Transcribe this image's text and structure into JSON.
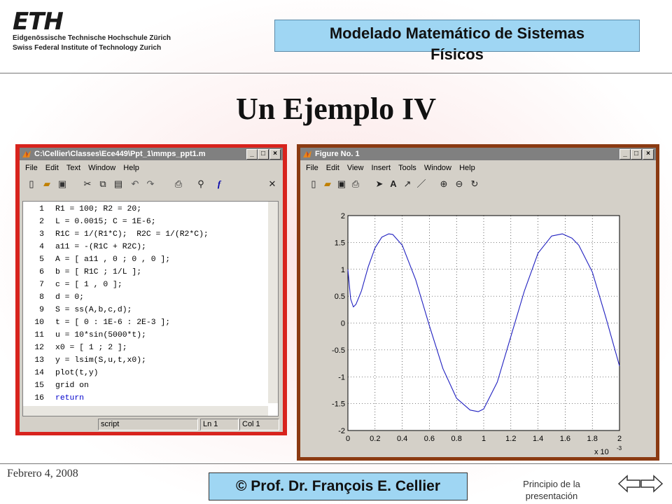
{
  "header": {
    "eth_mark": "ETH",
    "eth_line1": "Eidgenössische Technische Hochschule Zürich",
    "eth_line2": "Swiss Federal Institute of Technology Zurich",
    "course_title_line1": "Modelado Matemático de Sistemas",
    "course_title_line2": "Físicos"
  },
  "slide_title": "Un Ejemplo IV",
  "footer": {
    "date": "Febrero 4, 2008",
    "author": "©  Prof. Dr. François E. Cellier",
    "nav_link_line1": "Principio de la",
    "nav_link_line2": "presentación"
  },
  "editor": {
    "title": "C:\\Cellier\\Classes\\Ece449\\Ppt_1\\mmps_ppt1.m",
    "menu": [
      "File",
      "Edit",
      "Text",
      "Window",
      "Help"
    ],
    "lines": [
      {
        "n": "1",
        "code": "R1 = 100; R2 = 20;"
      },
      {
        "n": "2",
        "code": "L = 0.0015; C = 1E-6;"
      },
      {
        "n": "3",
        "code": "R1C = 1/(R1*C);  R2C = 1/(R2*C);"
      },
      {
        "n": "4",
        "code": "a11 = -(R1C + R2C);"
      },
      {
        "n": "5",
        "code": "A = [ a11 , 0 ; 0 , 0 ];"
      },
      {
        "n": "6",
        "code": "b = [ R1C ; 1/L ];"
      },
      {
        "n": "7",
        "code": "c = [ 1 , 0 ];"
      },
      {
        "n": "8",
        "code": "d = 0;"
      },
      {
        "n": "9",
        "code": "S = ss(A,b,c,d);"
      },
      {
        "n": "10",
        "code": "t = [ 0 : 1E-6 : 2E-3 ];"
      },
      {
        "n": "11",
        "code": "u = 10*sin(5000*t);"
      },
      {
        "n": "12",
        "code": "x0 = [ 1 ; 2 ];"
      },
      {
        "n": "13",
        "code": "y = lsim(S,u,t,x0);"
      },
      {
        "n": "14",
        "code": "plot(t,y)"
      },
      {
        "n": "15",
        "code": "grid on"
      },
      {
        "n": "16",
        "code": "return"
      }
    ],
    "keyword_color": "#0000cc",
    "status": {
      "mode": "script",
      "line": "Ln 1",
      "col": "Col 1"
    }
  },
  "figure": {
    "title": "Figure No. 1",
    "menu": [
      "File",
      "Edit",
      "View",
      "Insert",
      "Tools",
      "Window",
      "Help"
    ],
    "x_exponent_label": "x 10",
    "x_exponent_power": "-3"
  },
  "chart_data": {
    "type": "line",
    "title": "",
    "xlabel": "",
    "ylabel": "",
    "xlim": [
      0,
      2
    ],
    "ylim": [
      -2,
      2
    ],
    "grid": true,
    "x_ticks": [
      0,
      0.2,
      0.4,
      0.6,
      0.8,
      1,
      1.2,
      1.4,
      1.6,
      1.8,
      2
    ],
    "x_tick_labels": [
      "0",
      "0.2",
      "0.4",
      "0.6",
      "0.8",
      "1",
      "1.2",
      "1.4",
      "1.6",
      "1.8",
      "2"
    ],
    "y_ticks": [
      2,
      1.5,
      1,
      0.5,
      0,
      -0.5,
      -1,
      -1.5,
      -2
    ],
    "y_tick_labels": [
      "2",
      "1.5",
      "1",
      "0.5",
      "0",
      "-0.5",
      "-1",
      "-1.5",
      "-2"
    ],
    "series": [
      {
        "color": "#2020c0",
        "x": [
          0,
          0.02,
          0.04,
          0.06,
          0.1,
          0.15,
          0.2,
          0.25,
          0.3,
          0.33,
          0.4,
          0.5,
          0.6,
          0.7,
          0.8,
          0.9,
          0.96,
          1.0,
          1.1,
          1.2,
          1.3,
          1.4,
          1.5,
          1.58,
          1.65,
          1.7,
          1.8,
          1.9,
          2.0
        ],
        "y": [
          1.0,
          0.45,
          0.3,
          0.35,
          0.6,
          1.05,
          1.4,
          1.6,
          1.66,
          1.65,
          1.45,
          0.8,
          -0.05,
          -0.85,
          -1.4,
          -1.62,
          -1.65,
          -1.6,
          -1.1,
          -0.25,
          0.6,
          1.3,
          1.62,
          1.66,
          1.58,
          1.45,
          0.95,
          0.1,
          -0.8
        ]
      }
    ]
  }
}
